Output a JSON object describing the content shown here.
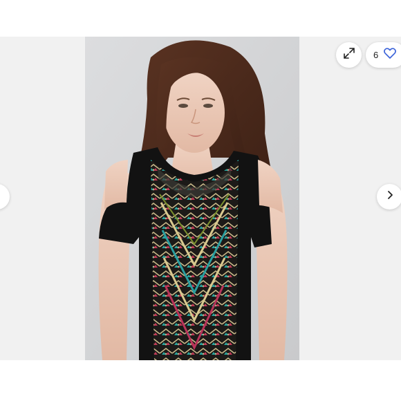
{
  "viewer": {
    "like_count": "6",
    "colors": {
      "accent": "#3b63d9",
      "stage_bg": "#f1f1f1",
      "control_bg": "#ffffff"
    }
  },
  "icons": {
    "expand": "expand-arrows-icon",
    "like": "heart-outline-icon",
    "prev": "chevron-left-icon",
    "next": "chevron-right-icon"
  }
}
